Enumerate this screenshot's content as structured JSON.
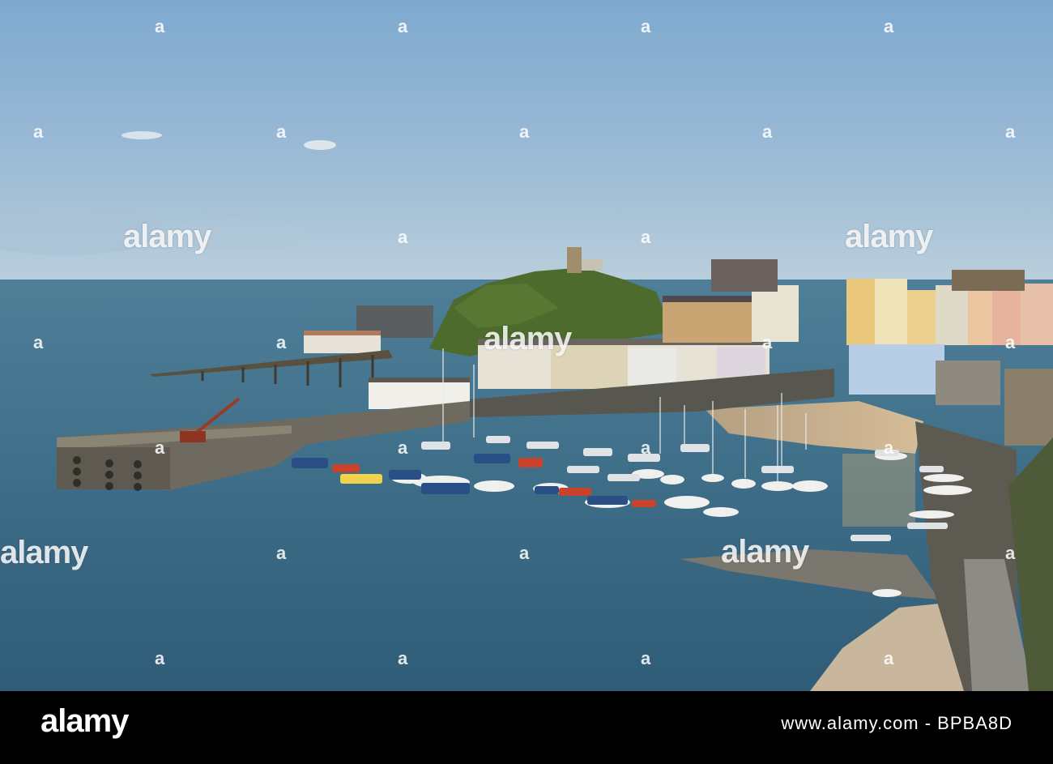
{
  "watermark": {
    "brand": "alamy",
    "mark": "a"
  },
  "footer": {
    "logo": "alamy",
    "image_id": "www.alamy.com - BPBA8D"
  },
  "colors": {
    "sky_top": "#7ea9cf",
    "sky_horizon": "#b9cedb",
    "sea": "#3e6d88",
    "sea_deep": "#2a536c",
    "sand": "#c9b293",
    "hill_green": "#4c6b2c"
  }
}
